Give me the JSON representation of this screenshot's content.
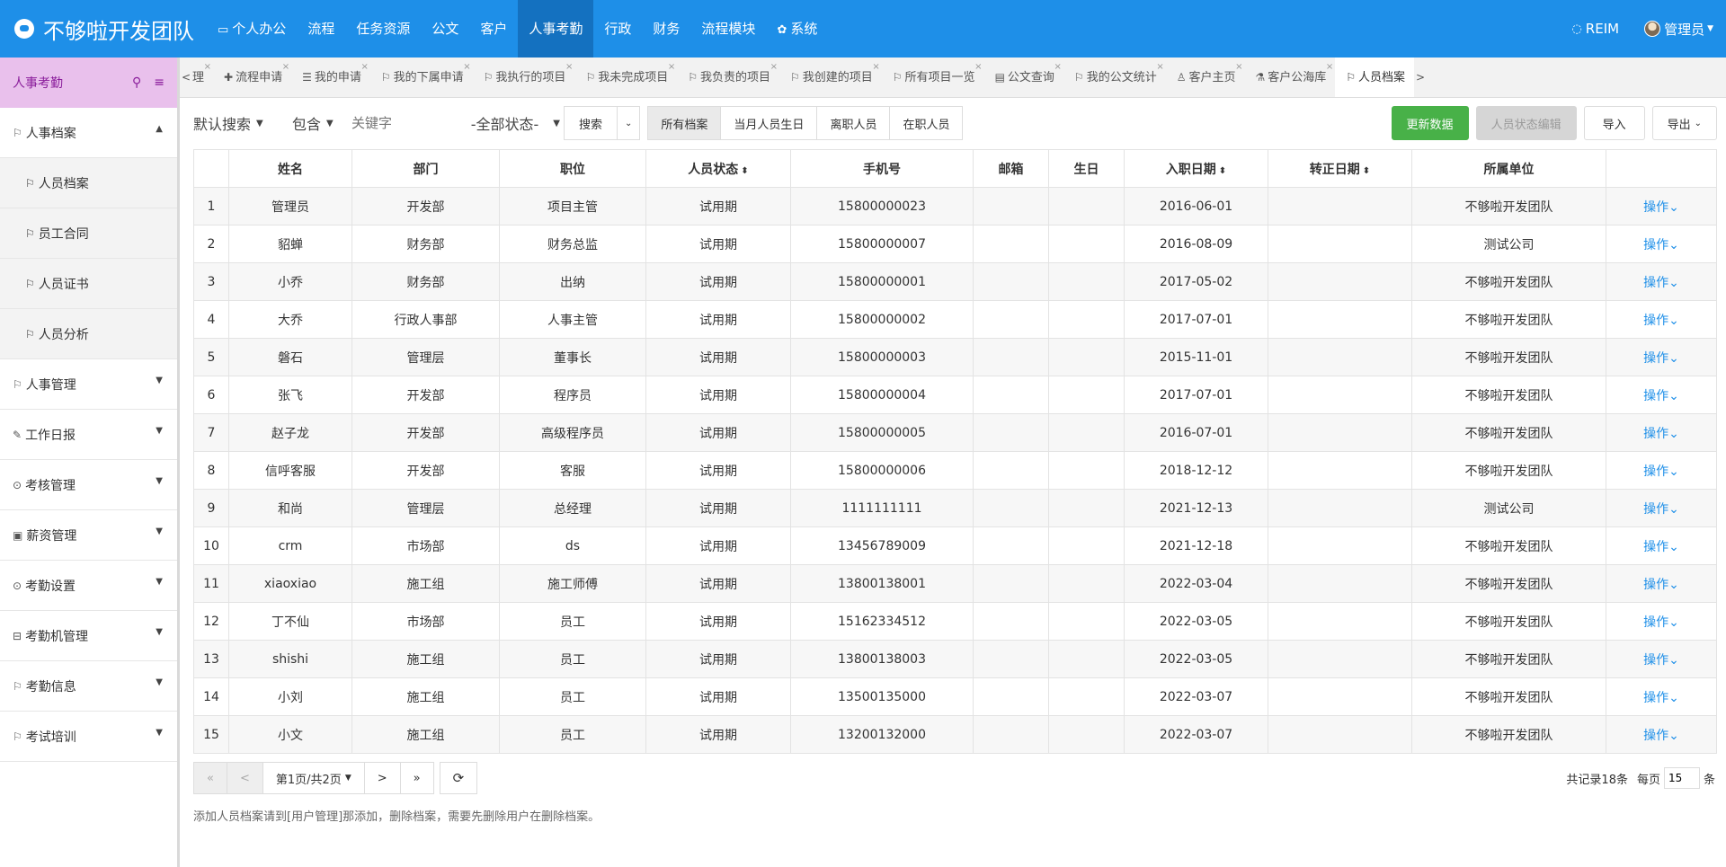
{
  "app": {
    "title": "不够啦开发团队"
  },
  "nav": {
    "items": [
      {
        "label": "个人办公",
        "icon": "▭"
      },
      {
        "label": "流程"
      },
      {
        "label": "任务资源"
      },
      {
        "label": "公文"
      },
      {
        "label": "客户"
      },
      {
        "label": "人事考勤",
        "active": true
      },
      {
        "label": "行政"
      },
      {
        "label": "财务"
      },
      {
        "label": "流程模块"
      },
      {
        "label": "系统",
        "icon": "✿"
      }
    ],
    "reim": "REIM",
    "user": "管理员"
  },
  "sidebar": {
    "title": "人事考勤",
    "groups": [
      {
        "label": "人事档案",
        "icon": "⚐",
        "open": true,
        "children": [
          "人员档案",
          "员工合同",
          "人员证书",
          "人员分析"
        ]
      },
      {
        "label": "人事管理",
        "icon": "⚐"
      },
      {
        "label": "工作日报",
        "icon": "✎"
      },
      {
        "label": "考核管理",
        "icon": "⊙"
      },
      {
        "label": "薪资管理",
        "icon": "▣"
      },
      {
        "label": "考勤设置",
        "icon": "⊙"
      },
      {
        "label": "考勤机管理",
        "icon": "⊟"
      },
      {
        "label": "考勤信息",
        "icon": "⚐"
      },
      {
        "label": "考试培训",
        "icon": "⚐"
      }
    ]
  },
  "tabs": {
    "left_arrow": "<",
    "right_arrow": ">",
    "items": [
      {
        "label": "理",
        "icon": ""
      },
      {
        "label": "流程申请",
        "icon": "✚"
      },
      {
        "label": "我的申请",
        "icon": "☰"
      },
      {
        "label": "我的下属申请",
        "icon": "⚐"
      },
      {
        "label": "我执行的项目",
        "icon": "⚐"
      },
      {
        "label": "我未完成项目",
        "icon": "⚐"
      },
      {
        "label": "我负责的项目",
        "icon": "⚐"
      },
      {
        "label": "我创建的项目",
        "icon": "⚐"
      },
      {
        "label": "所有项目一览",
        "icon": "⚐"
      },
      {
        "label": "公文查询",
        "icon": "▤"
      },
      {
        "label": "我的公文统计",
        "icon": "⚐"
      },
      {
        "label": "客户主页",
        "icon": "♙"
      },
      {
        "label": "客户公海库",
        "icon": "⚗"
      },
      {
        "label": "人员档案",
        "icon": "⚐",
        "active": true
      }
    ]
  },
  "toolbar": {
    "search_mode": "默认搜索",
    "match": "包含",
    "keyword_placeholder": "关键字",
    "status": "-全部状态-",
    "search_btn": "搜索",
    "filters": [
      "所有档案",
      "当月人员生日",
      "离职人员",
      "在职人员"
    ],
    "update_btn": "更新数据",
    "status_edit_btn": "人员状态编辑",
    "import_btn": "导入",
    "export_btn": "导出"
  },
  "table": {
    "columns": [
      "",
      "姓名",
      "部门",
      "职位",
      "人员状态",
      "手机号",
      "邮箱",
      "生日",
      "入职日期",
      "转正日期",
      "所属单位",
      ""
    ],
    "op_label": "操作",
    "rows": [
      [
        "1",
        "管理员",
        "开发部",
        "项目主管",
        "试用期",
        "15800000023",
        "",
        "",
        "2016-06-01",
        "",
        "不够啦开发团队"
      ],
      [
        "2",
        "貂蝉",
        "财务部",
        "财务总监",
        "试用期",
        "15800000007",
        "",
        "",
        "2016-08-09",
        "",
        "测试公司"
      ],
      [
        "3",
        "小乔",
        "财务部",
        "出纳",
        "试用期",
        "15800000001",
        "",
        "",
        "2017-05-02",
        "",
        "不够啦开发团队"
      ],
      [
        "4",
        "大乔",
        "行政人事部",
        "人事主管",
        "试用期",
        "15800000002",
        "",
        "",
        "2017-07-01",
        "",
        "不够啦开发团队"
      ],
      [
        "5",
        "磐石",
        "管理层",
        "董事长",
        "试用期",
        "15800000003",
        "",
        "",
        "2015-11-01",
        "",
        "不够啦开发团队"
      ],
      [
        "6",
        "张飞",
        "开发部",
        "程序员",
        "试用期",
        "15800000004",
        "",
        "",
        "2017-07-01",
        "",
        "不够啦开发团队"
      ],
      [
        "7",
        "赵子龙",
        "开发部",
        "高级程序员",
        "试用期",
        "15800000005",
        "",
        "",
        "2016-07-01",
        "",
        "不够啦开发团队"
      ],
      [
        "8",
        "信呼客服",
        "开发部",
        "客服",
        "试用期",
        "15800000006",
        "",
        "",
        "2018-12-12",
        "",
        "不够啦开发团队"
      ],
      [
        "9",
        "和尚",
        "管理层",
        "总经理",
        "试用期",
        "1111111111",
        "",
        "",
        "2021-12-13",
        "",
        "测试公司"
      ],
      [
        "10",
        "crm",
        "市场部",
        "ds",
        "试用期",
        "13456789009",
        "",
        "",
        "2021-12-18",
        "",
        "不够啦开发团队"
      ],
      [
        "11",
        "xiaoxiao",
        "施工组",
        "施工师傅",
        "试用期",
        "13800138001",
        "",
        "",
        "2022-03-04",
        "",
        "不够啦开发团队"
      ],
      [
        "12",
        "丁不仙",
        "市场部",
        "员工",
        "试用期",
        "15162334512",
        "",
        "",
        "2022-03-05",
        "",
        "不够啦开发团队"
      ],
      [
        "13",
        "shishi",
        "施工组",
        "员工",
        "试用期",
        "13800138003",
        "",
        "",
        "2022-03-05",
        "",
        "不够啦开发团队"
      ],
      [
        "14",
        "小刘",
        "施工组",
        "员工",
        "试用期",
        "13500135000",
        "",
        "",
        "2022-03-07",
        "",
        "不够啦开发团队"
      ],
      [
        "15",
        "小文",
        "施工组",
        "员工",
        "试用期",
        "13200132000",
        "",
        "",
        "2022-03-07",
        "",
        "不够啦开发团队"
      ]
    ]
  },
  "pager": {
    "first": "«",
    "prev": "<",
    "page_info": "第1页/共2页",
    "next": ">",
    "last": "»",
    "total": "共记录18条",
    "per_page_label": "每页",
    "per_page": "15",
    "unit": "条"
  },
  "note": "添加人员档案请到[用户管理]那添加，删除档案，需要先删除用户在删除档案。",
  "colors": {
    "nav_bg": "#1e8fe8",
    "nav_active": "#1471c0",
    "sidebar_head": "#e9c0ec",
    "green": "#48b148",
    "link": "#1e8fe8"
  }
}
